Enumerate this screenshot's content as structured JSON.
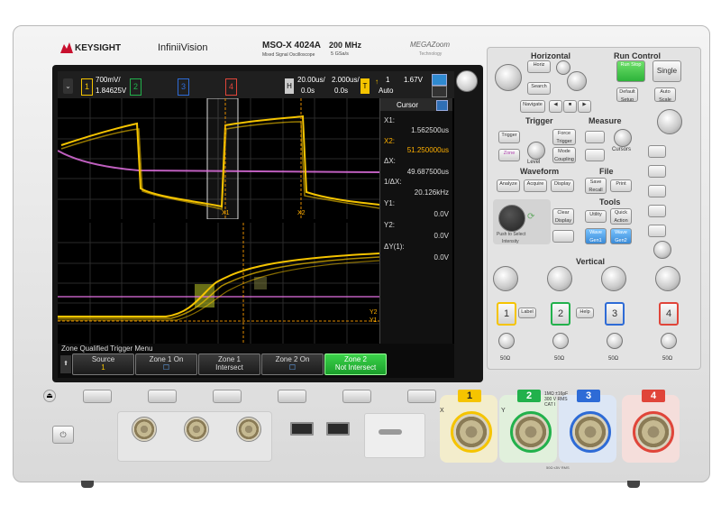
{
  "brand": {
    "logo_text": "KEYSIGHT",
    "series": "InfiniiVision",
    "model": "MSO-X 4024A",
    "model_subtitle": "Mixed Signal Oscilloscope",
    "bandwidth": "200 MHz",
    "sample_rate": "5 GSa/s",
    "megazoom": "MEGAZoom",
    "megazoom_sub": "Technology"
  },
  "status": {
    "ch1_scale": "700mV/",
    "ch1_offset": "1.84625V",
    "ch_labels": [
      "1",
      "2",
      "3",
      "4"
    ],
    "h_label": "H",
    "h_scale": "20.00us/",
    "h_delay": "0.0s",
    "zoom_scale": "2.000us/",
    "zoom_delay": "0.0s",
    "t_label": "T",
    "trig_src": "1",
    "trig_level": "1.67V",
    "trig_mode": "Auto"
  },
  "cursor_panel": {
    "title": "Cursor",
    "x1_label": "X1:",
    "x1_value": "1.562500us",
    "x2_label": "X2:",
    "x2_value": "51.250000us",
    "dx_label": "ΔX:",
    "dx_value": "49.687500us",
    "inv_label": "1/ΔX:",
    "inv_value": "20.126kHz",
    "y1_label": "Y1:",
    "y1_value": "0.0V",
    "y2_label": "Y2:",
    "y2_value": "0.0V",
    "dy_label": "ΔY(1):",
    "dy_value": "0.0V"
  },
  "markers": {
    "x1": "X1",
    "x2": "X2",
    "y1": "Y1",
    "y2": "Y2"
  },
  "softmenu": {
    "title": "Zone Qualified Trigger Menu",
    "keys": [
      {
        "l1": "Source",
        "l2": "1"
      },
      {
        "l1": "Zone 1 On",
        "l2": "☐"
      },
      {
        "l1": "Zone 1",
        "l2": "Intersect"
      },
      {
        "l1": "Zone 2 On",
        "l2": "☐"
      },
      {
        "l1": "Zone 2",
        "l2": "Not Intersect"
      }
    ]
  },
  "panel": {
    "horizontal": "Horizontal",
    "run_control": "Run Control",
    "horiz": "Horiz",
    "search": "Search",
    "navigate": "Navigate",
    "run_stop": "Run Stop",
    "single": "Single",
    "default_setup": "Default Setup",
    "auto_scale": "Auto Scale",
    "trigger": "Trigger",
    "measure": "Measure",
    "trigger_btn": "Trigger",
    "force_trigger": "Force Trigger",
    "zone": "Zone",
    "level": "Level",
    "mode_coupling": "Mode Coupling",
    "cursors": "Cursors",
    "waveform": "Waveform",
    "file": "File",
    "analyze": "Analyze",
    "acquire": "Acquire",
    "display": "Display",
    "save_recall": "Save Recall",
    "print": "Print",
    "tools": "Tools",
    "clear_display": "Clear Display",
    "utility": "Utility",
    "quick_action": "Quick Action",
    "wave_gen1": "Wave Gen1",
    "wave_gen2": "Wave Gen2",
    "intensity": "Intensity",
    "push_to_select": "Push to Select",
    "vertical": "Vertical",
    "label": "Label",
    "help": "Help",
    "ch_buttons": [
      "1",
      "2",
      "3",
      "4"
    ],
    "ohms": [
      "50Ω",
      "50Ω",
      "50Ω",
      "50Ω"
    ]
  },
  "inputs": {
    "ch_nums": [
      "1",
      "2",
      "3",
      "4"
    ],
    "x_label": "X",
    "y_label": "Y",
    "spec": "1MΩ ±16pF 300 V RMS CAT I",
    "cat_spec": "50Ω ≤5V RMS"
  },
  "colors": {
    "ch1": "#f5c400",
    "ch2": "#22b14c",
    "ch3": "#2e6bd6",
    "ch4": "#e0453a",
    "math": "#e070e0",
    "bg": "#000000"
  }
}
